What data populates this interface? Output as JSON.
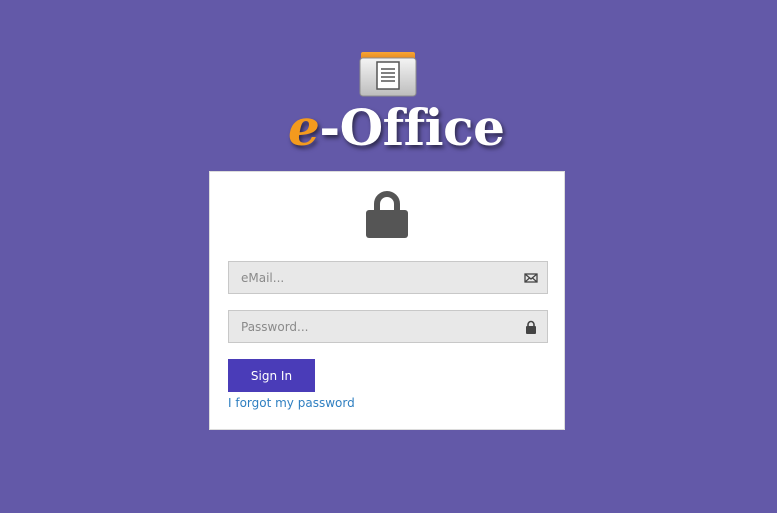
{
  "brand": {
    "prefix": "e",
    "suffix": "-Office",
    "accent_color": "#f39a1e",
    "logo_icon": "document-folder-icon"
  },
  "page": {
    "background_color": "#6359a8"
  },
  "login": {
    "header_icon": "lock-icon",
    "email": {
      "placeholder": "eMail...",
      "value": "",
      "icon": "envelope-icon"
    },
    "password": {
      "placeholder": "Password...",
      "value": "",
      "icon": "lock-icon"
    },
    "sign_in_label": "Sign In",
    "sign_in_color": "#4a3cb8",
    "forgot_label": "I forgot my password",
    "link_color": "#2f7fc1"
  }
}
